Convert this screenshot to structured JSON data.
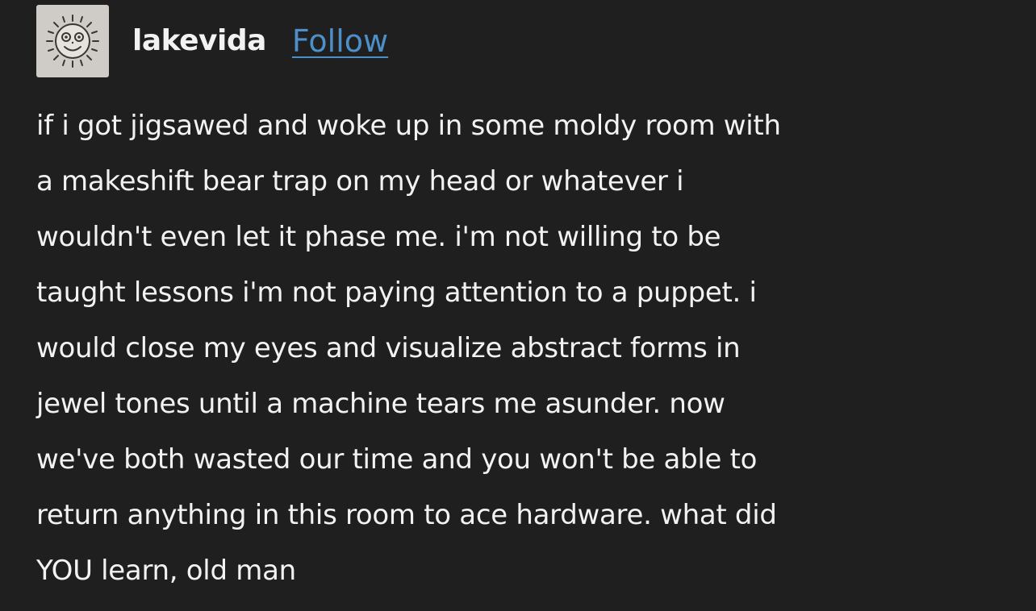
{
  "post": {
    "author": {
      "username": "lakevida",
      "avatar_icon": "smiling-sun-icon",
      "avatar_bg": "#cfcbc6"
    },
    "follow_label": "Follow",
    "colors": {
      "background": "#1f1f1f",
      "text": "#f2f2f2",
      "link": "#4d8fc8"
    },
    "body_lines": [
      "if i got jigsawed and woke up in some moldy room with",
      "a makeshift bear trap on my head or whatever i",
      "wouldn't even let it phase me. i'm not willing to be",
      "taught lessons i'm not paying attention to a puppet. i",
      "would close my eyes and visualize abstract forms in",
      "jewel tones until a machine tears me asunder. now",
      "we've both wasted our time and you won't be able to",
      "return anything in this room to ace hardware. what did",
      "YOU learn, old man"
    ]
  }
}
